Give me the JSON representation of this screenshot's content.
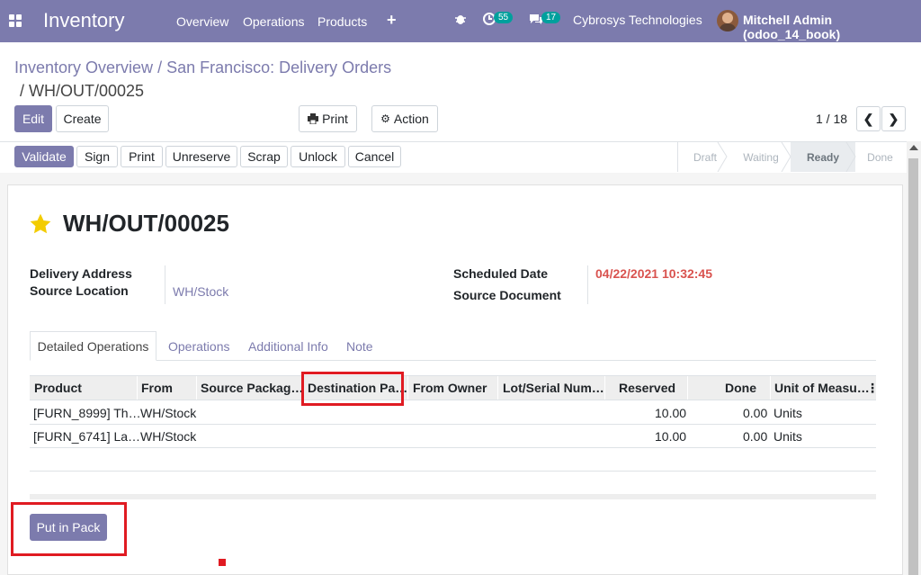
{
  "navbar": {
    "brand": "Inventory",
    "menu": [
      "Overview",
      "Operations",
      "Products"
    ],
    "activity_count": "55",
    "message_count": "17",
    "company": "Cybrosys Technologies",
    "user": "Mitchell Admin (odoo_14_book)"
  },
  "breadcrumb": {
    "part1": "Inventory Overview",
    "sep": " / ",
    "part2": "San Francisco: Delivery Orders",
    "part3": "/ WH/OUT/00025"
  },
  "control": {
    "edit": "Edit",
    "create": "Create",
    "print": "Print",
    "action": "Action",
    "pager": "1 / 18"
  },
  "header_buttons": [
    "Validate",
    "Sign",
    "Print",
    "Unreserve",
    "Scrap",
    "Unlock",
    "Cancel"
  ],
  "stages": [
    "Draft",
    "Waiting",
    "Ready",
    "Done"
  ],
  "record": {
    "name": "WH/OUT/00025",
    "delivery_address_label": "Delivery Address",
    "source_location_label": "Source Location",
    "source_location": "WH/Stock",
    "scheduled_date_label": "Scheduled Date",
    "scheduled_date": "04/22/2021 10:32:45",
    "source_document_label": "Source Document"
  },
  "tabs": [
    "Detailed Operations",
    "Operations",
    "Additional Info",
    "Note"
  ],
  "table": {
    "columns": [
      "Product",
      "From",
      "Source Packag…",
      "Destination Pa…",
      "From Owner",
      "Lot/Serial Num…",
      "Reserved",
      "Done",
      "Unit of Measu…"
    ],
    "rows": [
      {
        "product": "[FURN_8999] Th…",
        "from": "WH/Stock",
        "reserved": "10.00",
        "done": "0.00",
        "uom": "Units"
      },
      {
        "product": "[FURN_6741] La…",
        "from": "WH/Stock",
        "reserved": "10.00",
        "done": "0.00",
        "uom": "Units"
      }
    ]
  },
  "put_in_pack": "Put in Pack",
  "colors": {
    "primary": "#7c7bad",
    "highlight": "#e01b22",
    "badge": "#00a09d"
  }
}
